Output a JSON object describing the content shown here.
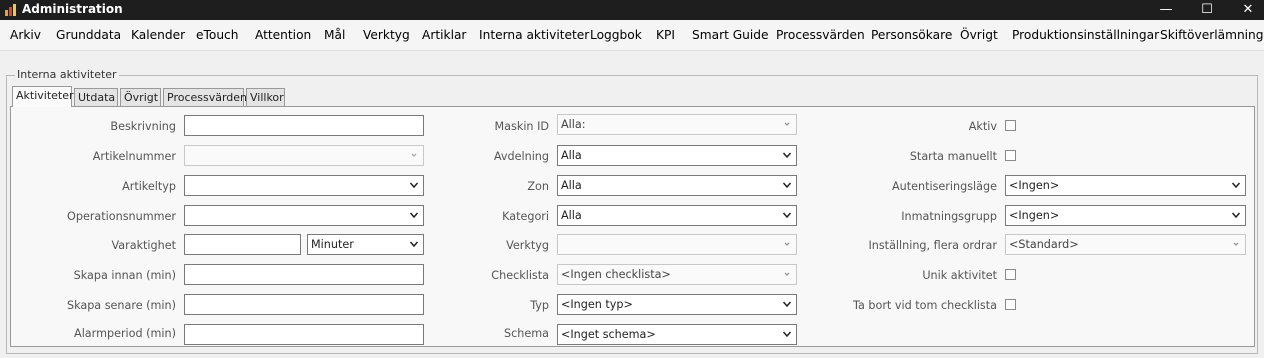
{
  "window": {
    "title": "Administration",
    "minimize": "—",
    "maximize": "☐",
    "close": "✕"
  },
  "menu": [
    "Arkiv",
    "Grunddata",
    "Kalender",
    "eTouch",
    "Attention",
    "Mål",
    "Verktyg",
    "Artiklar",
    "Interna aktiviteter",
    "Loggbok",
    "KPI",
    "Smart Guide",
    "Processvärden",
    "Personsökare",
    "Övrigt",
    "Produktionsinställningar",
    "Skiftöverlämning"
  ],
  "group": {
    "legend": "Interna aktiviteter"
  },
  "tabs": [
    "Aktiviteter",
    "Utdata",
    "Övrigt",
    "Processvärden",
    "Villkor"
  ],
  "left": {
    "beskrivning": {
      "label": "Beskrivning",
      "value": ""
    },
    "artikelnummer": {
      "label": "Artikelnummer",
      "value": ""
    },
    "artikeltyp": {
      "label": "Artikeltyp",
      "value": ""
    },
    "operationsnummer": {
      "label": "Operationsnummer",
      "value": ""
    },
    "varaktighet": {
      "label": "Varaktighet",
      "value": "",
      "unit": "Minuter"
    },
    "skapa_innan": {
      "label": "Skapa innan (min)",
      "value": ""
    },
    "skapa_senare": {
      "label": "Skapa senare (min)",
      "value": ""
    },
    "alarmperiod": {
      "label": "Alarmperiod (min)",
      "value": ""
    }
  },
  "middle": {
    "maskin_id": {
      "label": "Maskin ID",
      "value": "Alla:"
    },
    "avdelning": {
      "label": "Avdelning",
      "value": "Alla"
    },
    "zon": {
      "label": "Zon",
      "value": "Alla"
    },
    "kategori": {
      "label": "Kategori",
      "value": "Alla"
    },
    "verktyg": {
      "label": "Verktyg",
      "value": ""
    },
    "checklista": {
      "label": "Checklista",
      "value": "<Ingen checklista>"
    },
    "typ": {
      "label": "Typ",
      "value": "<Ingen typ>"
    },
    "schema": {
      "label": "Schema",
      "value": "<Inget schema>"
    }
  },
  "right": {
    "aktiv": {
      "label": "Aktiv",
      "checked": false
    },
    "starta_manuellt": {
      "label": "Starta manuellt",
      "checked": false
    },
    "autentiseringslage": {
      "label": "Autentiseringsläge",
      "value": "<Ingen>"
    },
    "inmatningsgrupp": {
      "label": "Inmatningsgrupp",
      "value": "<Ingen>"
    },
    "installning_flera_ordrar": {
      "label": "Inställning, flera ordrar",
      "value": "<Standard>"
    },
    "unik_aktivitet": {
      "label": "Unik aktivitet",
      "checked": false
    },
    "ta_bort_vid_tom_checklista": {
      "label": "Ta bort vid tom checklista",
      "checked": false
    }
  }
}
